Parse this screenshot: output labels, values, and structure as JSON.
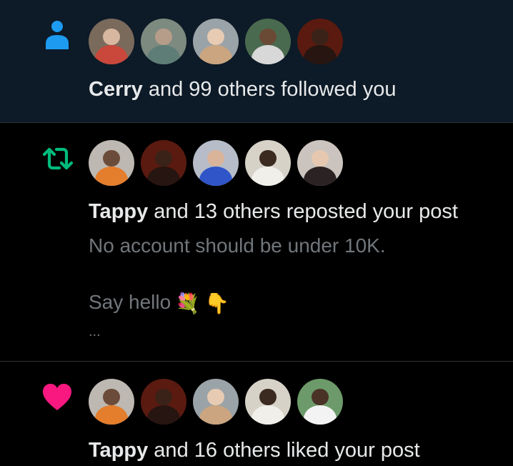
{
  "notifications": [
    {
      "type": "follow",
      "icon": "person-icon",
      "actor": "Cerry",
      "rest": " and 99 others followed you",
      "avatars": [
        {
          "bg": "#7a6a5c",
          "head": "#d8b7a1",
          "body": "#c9473b"
        },
        {
          "bg": "#7d8a80",
          "head": "#b69d8a",
          "body": "#5e7d76"
        },
        {
          "bg": "#9aa3a8",
          "head": "#e7cbb2",
          "body": "#caa57f"
        },
        {
          "bg": "#4a6a4f",
          "head": "#6b4a35",
          "body": "#d8d8d8"
        },
        {
          "bg": "#5a1a10",
          "head": "#3a2218",
          "body": "#261511"
        }
      ]
    },
    {
      "type": "repost",
      "icon": "repost-icon",
      "actor": "Tappy",
      "rest": " and 13 others reposted your post",
      "post_line1": "No account should be under 10K.",
      "post_line2": "Say hello",
      "emoji1": "💐",
      "emoji2": "👇",
      "ellipsis": "...",
      "avatars": [
        {
          "bg": "#bdb8b1",
          "head": "#6b4b3a",
          "body": "#e47d2c"
        },
        {
          "bg": "#5a1a10",
          "head": "#3a2218",
          "body": "#261511"
        },
        {
          "bg": "#b6bcc8",
          "head": "#d9b39a",
          "body": "#2f55c8"
        },
        {
          "bg": "#d6d2c8",
          "head": "#3a2a20",
          "body": "#f0efe9"
        },
        {
          "bg": "#cbc4be",
          "head": "#e6c8b0",
          "body": "#2b2323"
        }
      ]
    },
    {
      "type": "like",
      "icon": "heart-icon",
      "actor": "Tappy",
      "rest": " and 16 others liked your post",
      "avatars": [
        {
          "bg": "#bdb8b1",
          "head": "#6b4b3a",
          "body": "#e47d2c"
        },
        {
          "bg": "#5a1a10",
          "head": "#3a2218",
          "body": "#261511"
        },
        {
          "bg": "#9aa3a8",
          "head": "#e7cbb2",
          "body": "#caa57f"
        },
        {
          "bg": "#d6d2c8",
          "head": "#3a2a20",
          "body": "#f0efe9"
        },
        {
          "bg": "#6d9a6a",
          "head": "#4a3326",
          "body": "#f3f3f3"
        }
      ]
    }
  ],
  "colors": {
    "follow_icon": "#1d9bf0",
    "repost_icon": "#00ba7c",
    "like_icon": "#f91880",
    "secondary_text": "#71767b",
    "highlight_bg": "#0d1a27"
  }
}
